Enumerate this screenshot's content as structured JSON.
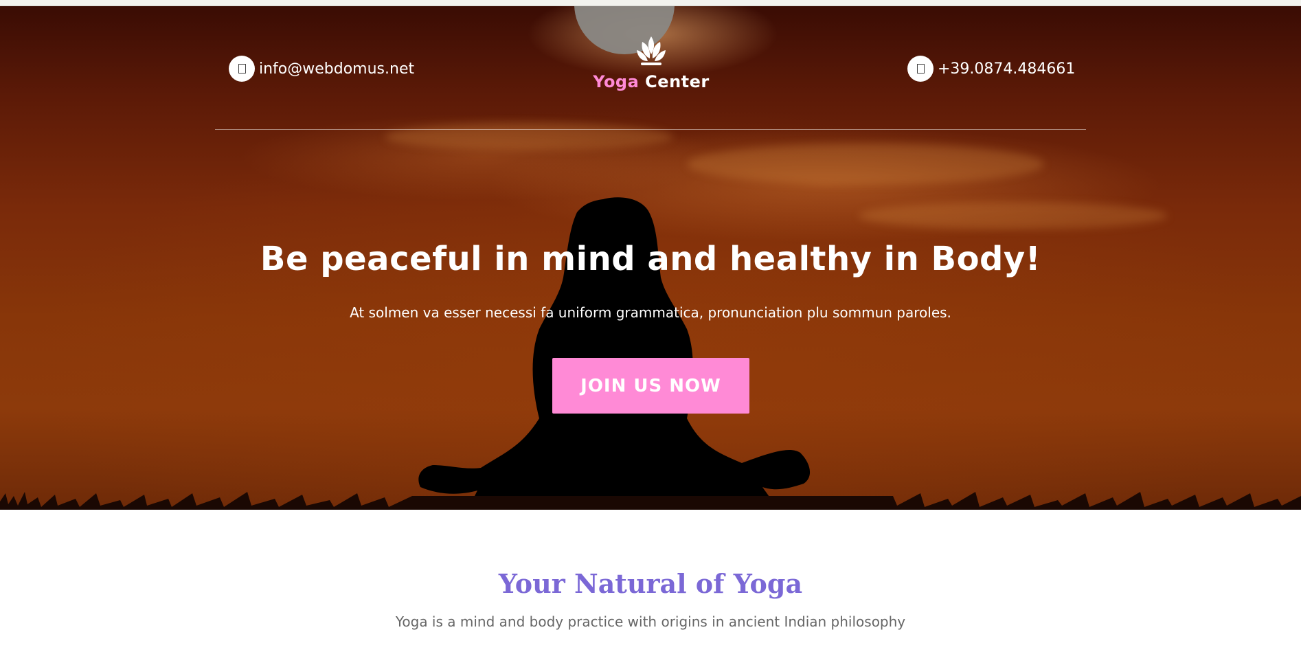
{
  "header": {
    "email": "info@webdomus.net",
    "email_icon": "envelope-icon",
    "phone": "+39.0874.484661",
    "phone_icon": "phone-icon",
    "logo_icon": "lotus-icon",
    "brand_first": "Yoga",
    "brand_second": "Center"
  },
  "hero": {
    "title": "Be peaceful in mind and healthy in Body!",
    "subtitle": "At solmen va esser necessi fa uniform grammatica, pronunciation plu sommun paroles.",
    "cta_label": "JOIN US NOW"
  },
  "section": {
    "title": "Your Natural of Yoga",
    "subtitle": "Yoga is a mind and body practice with origins in ancient Indian philosophy"
  },
  "colors": {
    "accent_pink": "#ff8ad6",
    "section_title": "#7b68d6",
    "hero_sky": "#7a2a0a"
  }
}
